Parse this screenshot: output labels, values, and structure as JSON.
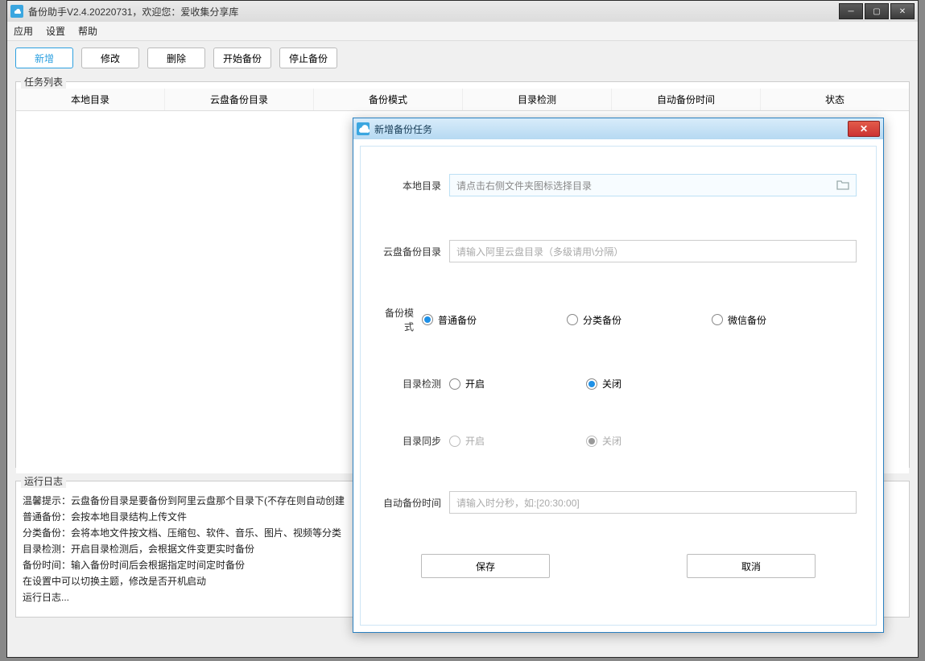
{
  "window": {
    "title": "备份助手V2.4.20220731，欢迎您：爱收集分享库"
  },
  "menubar": {
    "app": "应用",
    "settings": "设置",
    "help": "帮助"
  },
  "toolbar": {
    "new": "新增",
    "edit": "修改",
    "delete": "删除",
    "start": "开始备份",
    "stop": "停止备份"
  },
  "taskList": {
    "legend": "任务列表",
    "headers": {
      "localDir": "本地目录",
      "cloudDir": "云盘备份目录",
      "mode": "备份模式",
      "dirCheck": "目录检测",
      "autoTime": "自动备份时间",
      "status": "状态"
    }
  },
  "log": {
    "legend": "运行日志",
    "lines": [
      "温馨提示：云盘备份目录是要备份到阿里云盘那个目录下(不存在则自动创建",
      "普通备份：会按本地目录结构上传文件",
      "分类备份：会将本地文件按文档、压缩包、软件、音乐、图片、视频等分类",
      "目录检测：开启目录检测后，会根据文件变更实时备份",
      "备份时间：输入备份时间后会根据指定时间定时备份",
      "在设置中可以切换主题，修改是否开机启动",
      "运行日志..."
    ]
  },
  "dialog": {
    "title": "新增备份任务",
    "labels": {
      "localDir": "本地目录",
      "cloudDir": "云盘备份目录",
      "mode": "备份模式",
      "dirCheck": "目录检测",
      "dirSync": "目录同步",
      "autoTime": "自动备份时间"
    },
    "placeholders": {
      "localDir": "请点击右侧文件夹图标选择目录",
      "cloudDir": "请输入阿里云盘目录（多级请用\\分隔）",
      "autoTime": "请输入时分秒，如:[20:30:00]"
    },
    "modeOptions": {
      "normal": "普通备份",
      "category": "分类备份",
      "wechat": "微信备份"
    },
    "switch": {
      "on": "开启",
      "off": "关闭"
    },
    "buttons": {
      "save": "保存",
      "cancel": "取消"
    }
  }
}
